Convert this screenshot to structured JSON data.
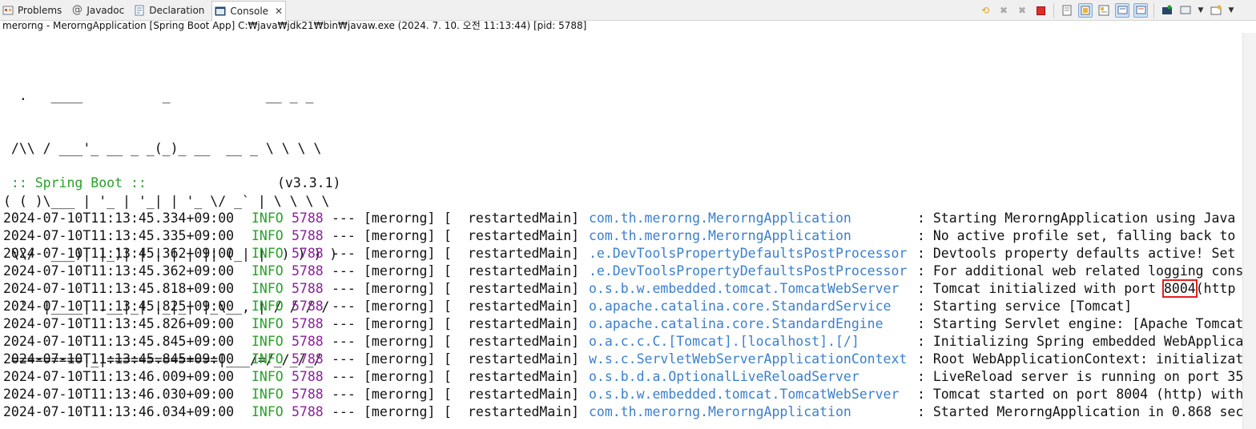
{
  "tabs": [
    {
      "label": "Problems",
      "icon": "problems-icon",
      "active": false
    },
    {
      "label": "Javadoc",
      "icon": "javadoc-icon",
      "active": false
    },
    {
      "label": "Declaration",
      "icon": "declaration-icon",
      "active": false
    },
    {
      "label": "Console",
      "icon": "console-icon",
      "active": true
    }
  ],
  "toolbar_icons": [
    "relaunch-icon",
    "remove-launch-icon",
    "remove-all-launches-icon",
    "terminate-icon",
    "clear-console-icon",
    "scroll-lock-icon",
    "word-wrap-icon",
    "show-on-stdout-icon",
    "show-on-stderr-icon",
    "pin-console-icon",
    "display-console-icon",
    "open-console-icon"
  ],
  "status_line": "merorng - MerorngApplication [Spring Boot App] C:₩java₩jdk21₩bin₩javaw.exe  (2024. 7. 10. 오전 11:13:44) [pid: 5788]",
  "banner": [
    "  .   ____          _            __ _ _",
    " /\\\\ / ___'_ __ _ _(_)_ __  __ _ \\ \\ \\ \\",
    "( ( )\\___ | '_ | '_| | '_ \\/ _` | \\ \\ \\ \\",
    " \\\\/  ___)| |_)| | | | | || (_| |  ) ) ) )",
    "  '  |____| .__|_| |_|_| |_\\__, | / / / /",
    " =========|_|==============|___/=/_/_/_/"
  ],
  "spring_boot_label": " :: Spring Boot :: ",
  "spring_boot_version": "(v3.3.1)",
  "highlighted_port": "8004",
  "logs": [
    {
      "ts": "2024-07-10T11:13:45.334+09:00",
      "level": "INFO",
      "pid": "5788",
      "sep": "---",
      "app": "[merorng]",
      "bracket": "[",
      "thread": "restartedMain]",
      "logger": "com.th.merorng.MerorngApplication",
      "msg": ": Starting MerorngApplication using Java"
    },
    {
      "ts": "2024-07-10T11:13:45.335+09:00",
      "level": "INFO",
      "pid": "5788",
      "sep": "---",
      "app": "[merorng]",
      "bracket": "[",
      "thread": "restartedMain]",
      "logger": "com.th.merorng.MerorngApplication",
      "msg": ": No active profile set, falling back to"
    },
    {
      "ts": "2024-07-10T11:13:45.362+09:00",
      "level": "INFO",
      "pid": "5788",
      "sep": "---",
      "app": "[merorng]",
      "bracket": "[",
      "thread": "restartedMain]",
      "logger": ".e.DevToolsPropertyDefaultsPostProcessor",
      "msg": ": Devtools property defaults active! Set"
    },
    {
      "ts": "2024-07-10T11:13:45.362+09:00",
      "level": "INFO",
      "pid": "5788",
      "sep": "---",
      "app": "[merorng]",
      "bracket": "[",
      "thread": "restartedMain]",
      "logger": ".e.DevToolsPropertyDefaultsPostProcessor",
      "msg": ": For additional web related logging cons"
    },
    {
      "ts": "2024-07-10T11:13:45.818+09:00",
      "level": "INFO",
      "pid": "5788",
      "sep": "---",
      "app": "[merorng]",
      "bracket": "[",
      "thread": "restartedMain]",
      "logger": "o.s.b.w.embedded.tomcat.TomcatWebServer",
      "msg": ": Tomcat initialized with port",
      "msg_after": "(http"
    },
    {
      "ts": "2024-07-10T11:13:45.825+09:00",
      "level": "INFO",
      "pid": "5788",
      "sep": "---",
      "app": "[merorng]",
      "bracket": "[",
      "thread": "restartedMain]",
      "logger": "o.apache.catalina.core.StandardService",
      "msg": ": Starting service [Tomcat]"
    },
    {
      "ts": "2024-07-10T11:13:45.826+09:00",
      "level": "INFO",
      "pid": "5788",
      "sep": "---",
      "app": "[merorng]",
      "bracket": "[",
      "thread": "restartedMain]",
      "logger": "o.apache.catalina.core.StandardEngine",
      "msg": ": Starting Servlet engine: [Apache Tomcat"
    },
    {
      "ts": "2024-07-10T11:13:45.845+09:00",
      "level": "INFO",
      "pid": "5788",
      "sep": "---",
      "app": "[merorng]",
      "bracket": "[",
      "thread": "restartedMain]",
      "logger": "o.a.c.c.C.[Tomcat].[localhost].[/]",
      "msg": ": Initializing Spring embedded WebApplica"
    },
    {
      "ts": "2024-07-10T11:13:45.845+09:00",
      "level": "INFO",
      "pid": "5788",
      "sep": "---",
      "app": "[merorng]",
      "bracket": "[",
      "thread": "restartedMain]",
      "logger": "w.s.c.ServletWebServerApplicationContext",
      "msg": ": Root WebApplicationContext: initializat"
    },
    {
      "ts": "2024-07-10T11:13:46.009+09:00",
      "level": "INFO",
      "pid": "5788",
      "sep": "---",
      "app": "[merorng]",
      "bracket": "[",
      "thread": "restartedMain]",
      "logger": "o.s.b.d.a.OptionalLiveReloadServer",
      "msg": ": LiveReload server is running on port 35"
    },
    {
      "ts": "2024-07-10T11:13:46.030+09:00",
      "level": "INFO",
      "pid": "5788",
      "sep": "---",
      "app": "[merorng]",
      "bracket": "[",
      "thread": "restartedMain]",
      "logger": "o.s.b.w.embedded.tomcat.TomcatWebServer",
      "msg": ": Tomcat started on port 8004 (http) with"
    },
    {
      "ts": "2024-07-10T11:13:46.034+09:00",
      "level": "INFO",
      "pid": "5788",
      "sep": "---",
      "app": "[merorng]",
      "bracket": "[",
      "thread": "restartedMain]",
      "logger": "com.th.merorng.MerorngApplication",
      "msg": ": Started MerorngApplication in 0.868 sec"
    }
  ],
  "colors": {
    "info": "#2aa02a",
    "pid": "#8a1f9c",
    "logger": "#3b7fcc",
    "highlight": "#e02020",
    "spring_boot": "#2aa02a"
  }
}
